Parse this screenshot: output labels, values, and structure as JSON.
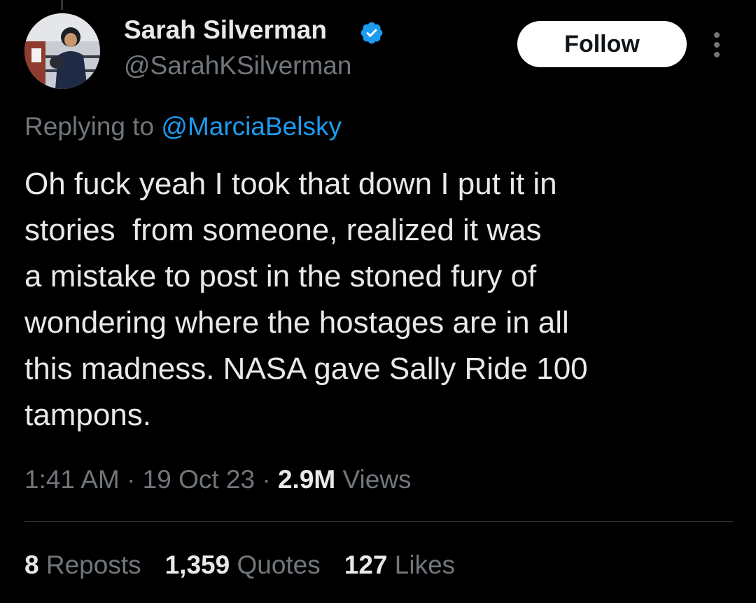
{
  "author": {
    "display_name": "Sarah Silverman",
    "handle": "@SarahKSilverman",
    "verified": true,
    "verified_color": "#1d9bf0"
  },
  "follow_button": {
    "label": "Follow"
  },
  "more_button": {
    "icon": "more-vertical-icon"
  },
  "reply": {
    "prefix": "Replying to",
    "mention": "@MarciaBelsky"
  },
  "tweet": {
    "lines": [
      "Oh fuck yeah I took that down I put it in",
      "stories  from someone, realized it was",
      "a mistake to post in the stoned fury of",
      "wondering where the hostages are in all",
      "this madness. NASA gave Sally Ride 100",
      "tampons."
    ]
  },
  "meta": {
    "time": "1:41 AM",
    "date": "19 Oct 23",
    "separator": "·",
    "views_count": "2.9M",
    "views_label": "Views"
  },
  "stats": {
    "reposts_count": "8",
    "reposts_label": "Reposts",
    "quotes_count": "1,359",
    "quotes_label": "Quotes",
    "likes_count": "127",
    "likes_label": "Likes"
  },
  "colors": {
    "background": "#000000",
    "text": "#e7e9ea",
    "muted": "#71767b",
    "accent": "#1d9bf0"
  }
}
